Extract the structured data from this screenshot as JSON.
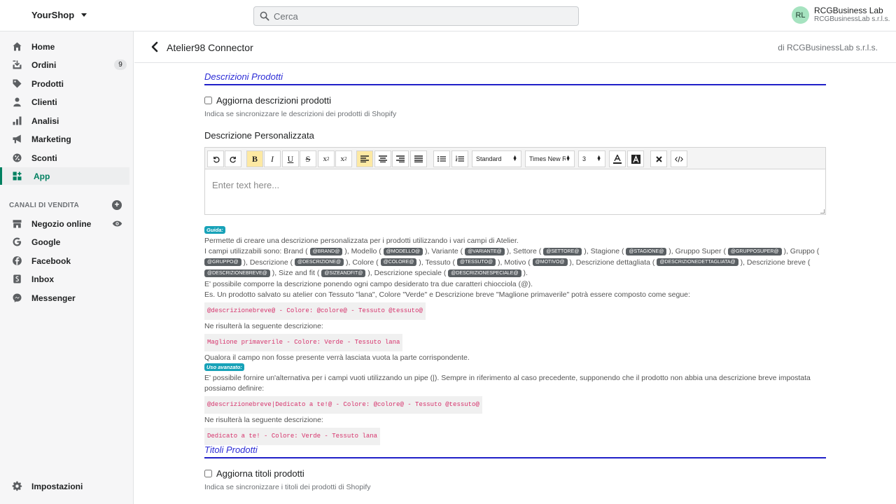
{
  "topbar": {
    "shop_name": "YourShop",
    "search_placeholder": "Cerca",
    "user_initials": "RL",
    "user_name": "RCGBusiness Lab",
    "user_company": "RCGBusinessLab s.r.l.s."
  },
  "sidebar": {
    "items": [
      {
        "label": "Home",
        "icon": "home-icon"
      },
      {
        "label": "Ordini",
        "icon": "orders-icon",
        "badge": "9"
      },
      {
        "label": "Prodotti",
        "icon": "tag-icon"
      },
      {
        "label": "Clienti",
        "icon": "person-icon"
      },
      {
        "label": "Analisi",
        "icon": "bar-chart-icon"
      },
      {
        "label": "Marketing",
        "icon": "megaphone-icon"
      },
      {
        "label": "Sconti",
        "icon": "discount-icon"
      },
      {
        "label": "App",
        "icon": "apps-icon",
        "active": true
      }
    ],
    "channels_heading": "CANALI DI VENDITA",
    "channels": [
      {
        "label": "Negozio online",
        "icon": "store-icon"
      },
      {
        "label": "Google",
        "icon": "google-icon"
      },
      {
        "label": "Facebook",
        "icon": "facebook-icon"
      },
      {
        "label": "Inbox",
        "icon": "inbox-icon"
      },
      {
        "label": "Messenger",
        "icon": "messenger-icon"
      }
    ],
    "settings_label": "Impostazioni"
  },
  "app_header": {
    "title": "Atelier98 Connector",
    "by": "di RCGBusinessLab s.r.l.s."
  },
  "descrizioni": {
    "section_title": "Descrizioni Prodotti",
    "checkbox_label": "Aggiorna descrizioni prodotti",
    "checkbox_help": "Indica se sincronizzare le descrizioni dei prodotti di Shopify",
    "field_label": "Descrizione Personalizzata",
    "editor_placeholder": "Enter text here...",
    "toolbar": {
      "format_select": "Standard",
      "font_select": "Times New R",
      "size_select": "3",
      "bold": "B",
      "italic": "I",
      "underline": "U",
      "strike": "S"
    }
  },
  "guide": {
    "tag": "Guida:",
    "line1": "Permette di creare una descrizione personalizzata per i prodotti utilizzando i vari campi di Atelier.",
    "fields_intro": "I campi utilizzabili sono:",
    "fields": [
      {
        "label": "Brand",
        "code": "@BRAND@"
      },
      {
        "label": "Modello",
        "code": "@MODELLO@"
      },
      {
        "label": "Variante",
        "code": "@VARIANTE@"
      },
      {
        "label": "Settore",
        "code": "@SETTORE@"
      },
      {
        "label": "Stagione",
        "code": "@STAGIONE@"
      },
      {
        "label": "Gruppo Super",
        "code": "@GRUPPOSUPER@"
      },
      {
        "label": "Gruppo",
        "code": "@GRUPPO@"
      },
      {
        "label": "Descrizione",
        "code": "@DESCRIZIONE@"
      },
      {
        "label": "Colore",
        "code": "@COLORE@"
      },
      {
        "label": "Tessuto",
        "code": "@TESSUTO@"
      },
      {
        "label": "Motivo",
        "code": "@MOTIVO@"
      },
      {
        "label": "Descrizione dettagliata",
        "code": "@DESCRIZIONEDETTAGLIATA@"
      },
      {
        "label": "Descrizione breve",
        "code": "@DESCRIZIONEBREVE@"
      },
      {
        "label": "Size and fit",
        "code": "@SIZEANDFIT@"
      },
      {
        "label": "Descrizione speciale",
        "code": "@DESCRIZIONESPECIALE@"
      }
    ],
    "line3": "E' possibile comporre la descrizione ponendo ogni campo desiderato tra due caratteri chiocciola (@).",
    "line4": "Es. Un prodotto salvato su atelier con Tessuto \"lana\", Colore \"Verde\" e Descrizione breve \"Maglione primaverile\" potrà essere composto come segue:",
    "code1": "@descrizionebreve@ - Colore: @colore@ - Tessuto @tessuto@",
    "line5": "Ne risulterà la seguente descrizione:",
    "code2": "Maglione primaverile - Colore: Verde - Tessuto lana",
    "line6": "Qualora il campo non fosse presente verrà lasciata vuota la parte corrispondente.",
    "adv_tag": "Uso avanzato:",
    "adv_line1": "E' possibile fornire un'alternativa per i campi vuoti utilizzando un pipe (|). Sempre in riferimento al caso precedente, supponendo che il prodotto non abbia una descrizione breve impostata possiamo definire:",
    "code3": "@descrizionebreve|Dedicato a te!@ - Colore: @colore@ - Tessuto @tessuto@",
    "adv_line2": "Ne risulterà la seguente descrizione:",
    "code4": "Dedicato a te! - Colore: Verde - Tessuto lana"
  },
  "titoli": {
    "section_title": "Titoli Prodotti",
    "checkbox_label": "Aggiorna titoli prodotti",
    "checkbox_help": "Indica se sincronizzare i titoli dei prodotti di Shopify"
  },
  "colors": {
    "accent": "#008060",
    "section_title": "#2c2cd6",
    "guide_tag": "#17a2b8"
  }
}
